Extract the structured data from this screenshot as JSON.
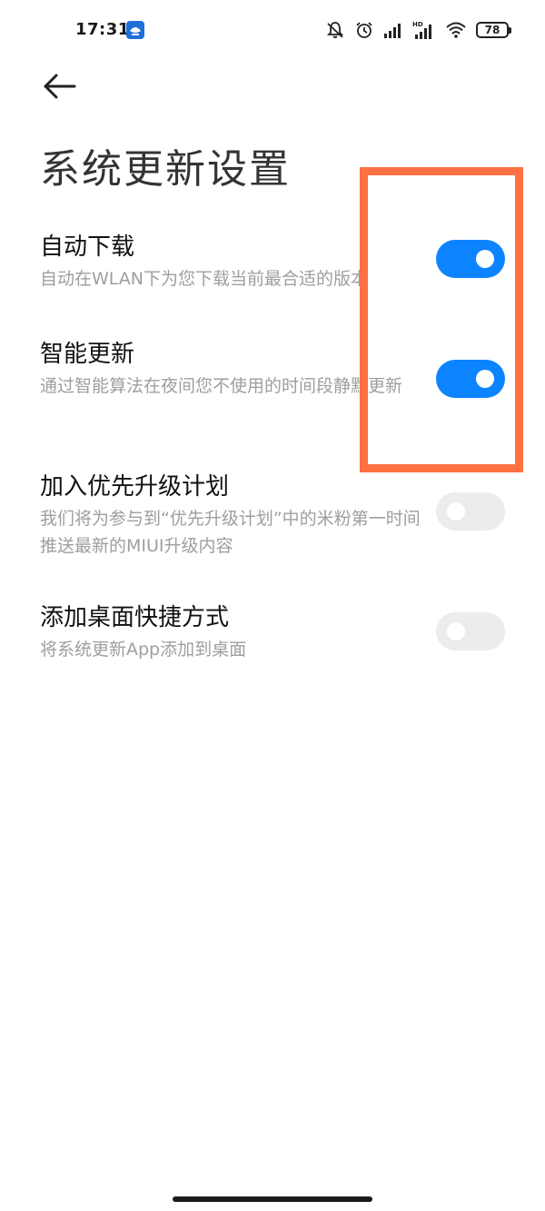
{
  "status_bar": {
    "time": "17:31",
    "battery": "78",
    "icons": [
      "app-notification-icon",
      "mute-icon",
      "alarm-icon",
      "signal-icon",
      "hd-signal-icon",
      "wifi-icon",
      "battery-icon"
    ]
  },
  "header": {
    "back_icon": "arrow-left-icon",
    "title": "系统更新设置"
  },
  "settings": [
    {
      "title": "自动下载",
      "desc": "自动在WLAN下为您下载当前最合适的版本",
      "enabled": true
    },
    {
      "title": "智能更新",
      "desc": "通过智能算法在夜间您不使用的时间段静默更新",
      "enabled": true
    },
    {
      "title": "加入优先升级计划",
      "desc": "我们将为参与到“优先升级计划”中的米粉第一时间推送最新的MIUI升级内容",
      "enabled": false
    },
    {
      "title": "添加桌面快捷方式",
      "desc": "将系统更新App添加到桌面",
      "enabled": false
    }
  ],
  "colors": {
    "toggle_on": "#0d84ff",
    "toggle_off": "#ececec",
    "highlight": "#ff7043"
  }
}
